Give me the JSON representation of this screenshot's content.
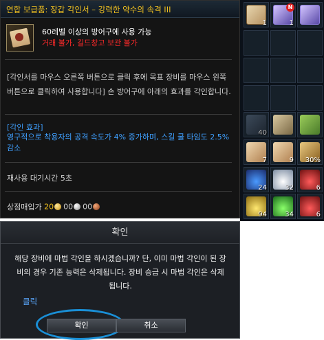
{
  "tooltip": {
    "title": "연합 보급품: 장갑 각인서 – 강력한 약수의 속격 III",
    "requirement": "60레벨 이상의 방어구에 사용 가능",
    "trade_restriction": "거래 불가, 길드창고 보관 불가",
    "description": "[각인서를 마우스 오른쪽 버튼으로 클릭 후에 목표 장비를 마우스 왼쪽 버튼으로 클릭하여 사용합니다] 손 방어구에 아래의 효과를 각인합니다.",
    "effect_header": "[각인 효과]",
    "effect_text": "영구적으로 착용자의 공격 속도가 4% 증가하며, 스킬 쿨 타임도 2.5% 감소",
    "cooldown": "재사용 대기시간  5초",
    "price_label": "상점매입가",
    "price_gold": "20",
    "price_silver": "00",
    "price_copper": "00"
  },
  "inventory": {
    "badge_new": "N",
    "counts": [
      "1",
      "1",
      "40",
      "7",
      "9",
      "30%",
      "24",
      "32",
      "6",
      "94",
      "34",
      "6"
    ]
  },
  "dialog": {
    "title": "확인",
    "message": "해당 장비에 마법 각인을 하시겠습니까? 단, 이미 마법 각인이 된 장비의 경우 기존 능력은 삭제됩니다. 장비 승급 시 마법 각인은 삭제됩니다.",
    "hint": "클릭",
    "ok_label": "확인",
    "cancel_label": "취소"
  }
}
